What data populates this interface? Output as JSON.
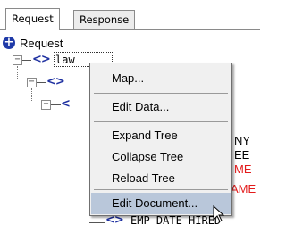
{
  "tabs": [
    {
      "label": "Request",
      "active": true
    },
    {
      "label": "Response",
      "active": false
    }
  ],
  "tree": {
    "header_label": "Request",
    "root_tag": "<>",
    "root_label": "law",
    "child_tag": "<>",
    "grandchild_tag": "<",
    "bottom_tag": "<>",
    "bottom_label": "EMP-DATE-HIRED",
    "trailing_labels": [
      {
        "text": "NY",
        "color": "#000000"
      },
      {
        "text": "EE",
        "color": "#000000"
      },
      {
        "text": "ME",
        "color": "#e31b1b"
      },
      {
        "text": "AME",
        "color": "#e31b1b"
      }
    ]
  },
  "context_menu": {
    "items": [
      {
        "label": "Map..."
      },
      {
        "label": "Edit Data..."
      },
      {
        "label": "Expand Tree"
      },
      {
        "label": "Collapse Tree"
      },
      {
        "label": "Reload Tree"
      },
      {
        "label": "Edit Document...",
        "highlighted": true
      }
    ],
    "highlight_color": "#b9c7da"
  },
  "icons": {
    "request_icon": "plus-circle-icon",
    "expander": "minus-box-icon",
    "cursor": "mouse-pointer-icon"
  }
}
